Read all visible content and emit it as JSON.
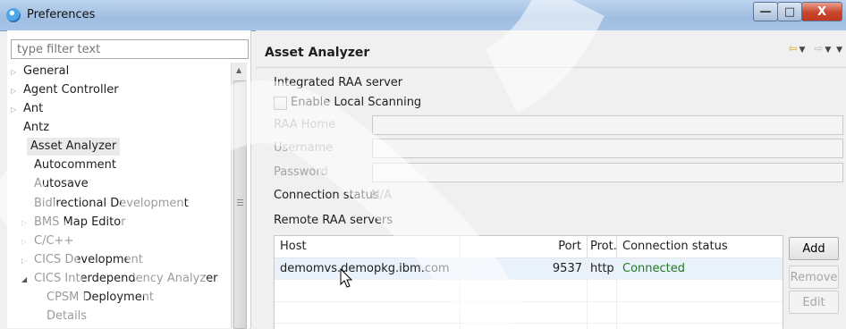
{
  "window": {
    "title": "Preferences",
    "min_glyph": "—",
    "max_glyph": "□",
    "close_glyph": "X"
  },
  "left": {
    "filter_placeholder": "type filter text",
    "tree": [
      {
        "label": "General",
        "twisty": "▷",
        "indent": 0
      },
      {
        "label": "Agent Controller",
        "twisty": "▷",
        "indent": 0
      },
      {
        "label": "Ant",
        "twisty": "▷",
        "indent": 0
      },
      {
        "label": "Antz",
        "twisty": "",
        "indent": 0
      },
      {
        "label": "Asset Analyzer",
        "twisty": "",
        "indent": 0,
        "selected": true
      },
      {
        "label": "Autocomment",
        "twisty": "",
        "indent": 0
      },
      {
        "label": "Autosave",
        "twisty": "",
        "indent": 0
      },
      {
        "label": "Bidirectional Development",
        "twisty": "",
        "indent": 0
      },
      {
        "label": "BMS Map Editor",
        "twisty": "▷",
        "indent": 0
      },
      {
        "label": "C/C++",
        "twisty": "▷",
        "indent": 0
      },
      {
        "label": "CICS Development",
        "twisty": "▷",
        "indent": 0
      },
      {
        "label": "CICS Interdependency Analyzer",
        "twisty": "◢",
        "indent": 0
      },
      {
        "label": "CPSM Deployment",
        "twisty": "",
        "indent": 1
      },
      {
        "label": "Details",
        "twisty": "",
        "indent": 1
      }
    ]
  },
  "page": {
    "title": "Asset Analyzer",
    "integrated_label": "Integrated RAA server",
    "enable_local_label": "Enable Local Scanning",
    "raa_home_label": "RAA Home",
    "username_label": "Username",
    "password_label": "Password",
    "connection_status_label": "Connection status",
    "connection_status_value": "N/A",
    "remote_label": "Remote RAA servers",
    "table": {
      "headers": [
        "Host",
        "Port",
        "Prot...",
        "Connection status"
      ],
      "rows": [
        {
          "host": "demomvs.demopkg.ibm.com",
          "port": "9537",
          "protocol": "http",
          "status": "Connected"
        }
      ]
    },
    "buttons": {
      "add": "Add",
      "remove": "Remove",
      "edit": "Edit"
    }
  },
  "colors": {
    "connected": "#1f7a1f",
    "selection": "#e9f1fb",
    "accent": "#d6a62a"
  }
}
